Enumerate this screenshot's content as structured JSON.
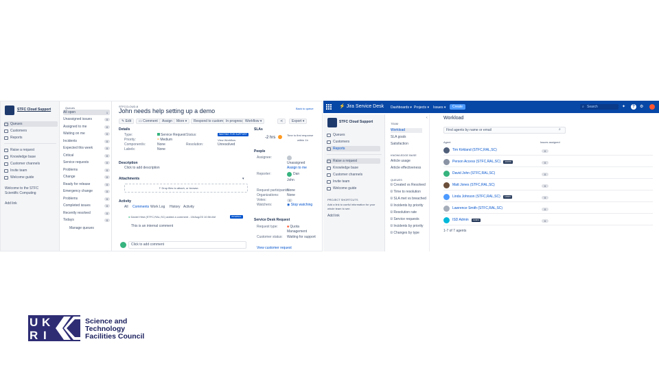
{
  "left_screenshot": {
    "project": {
      "name": "STFC Cloud Support"
    },
    "nav_items": [
      {
        "label": "Queues",
        "icon": "queues-icon"
      },
      {
        "label": "Customers",
        "icon": "customers-icon"
      },
      {
        "label": "Reports",
        "icon": "reports-icon"
      },
      {
        "label": "Raise a request",
        "icon": "raise-request-icon"
      },
      {
        "label": "Knowledge base",
        "icon": "knowledge-base-icon"
      },
      {
        "label": "Customer channels",
        "icon": "customer-channels-icon"
      },
      {
        "label": "Invite team",
        "icon": "invite-team-icon"
      },
      {
        "label": "Welcome guide",
        "icon": "welcome-guide-icon"
      }
    ],
    "sidebar_footer": [
      "Welcome to the STFC",
      "Scientific Computing",
      "Add link"
    ],
    "queues_header": "Queues",
    "queues": [
      {
        "label": "All open",
        "count": "1"
      },
      {
        "label": "Unassigned issues",
        "count": "0"
      },
      {
        "label": "Assigned to me",
        "count": "0"
      },
      {
        "label": "Waiting on me",
        "count": "0"
      },
      {
        "label": "Incidents",
        "count": "0"
      },
      {
        "label": "Expected this week",
        "count": "0"
      },
      {
        "label": "Critical",
        "count": "0"
      },
      {
        "label": "Service requests",
        "count": "0"
      },
      {
        "label": "Problems",
        "count": "0"
      },
      {
        "label": "Change",
        "count": "0"
      },
      {
        "label": "Ready for release",
        "count": "0"
      },
      {
        "label": "Emergency change",
        "count": "0"
      },
      {
        "label": "Problems",
        "count": "0"
      },
      {
        "label": "Completed issues",
        "count": "0"
      },
      {
        "label": "Recently resolved",
        "count": "0"
      },
      {
        "label": "Todays",
        "count": "0"
      }
    ],
    "queues_footer": "Manage queues",
    "issue": {
      "breadcrumb": "STFCCLOUD-8",
      "title": "John needs help setting up a demo",
      "back_link": "Back to queue",
      "toolbar": [
        "Edit",
        "Comment",
        "Assign",
        "More",
        "Respond to customer",
        "In progress",
        "Workflow"
      ],
      "export_label": "Export",
      "details_header": "Details",
      "detail_labels": [
        "Type:",
        "Priority:",
        "Component/s:",
        "Labels:"
      ],
      "detail_values": [
        "Service Request",
        "Medium",
        "None",
        "None"
      ],
      "status_label": "Status:",
      "status_value": "WAITING FOR SUPPORT",
      "workflow_value": "View Workflow",
      "resolution_label": "Resolution:",
      "resolution_value": "Unresolved",
      "description_header": "Description",
      "description_placeholder": "Click to add description",
      "attachments_header": "Attachments",
      "attachments_drop": "Drop files to attach, or browse.",
      "activity_header": "Activity",
      "activity_tabs": [
        "All",
        "Comments",
        "Work Log",
        "History",
        "Activity"
      ],
      "comment_author": "Daniel Hirst (STFC,RAL,SC) added a comment - 15/Aug/23 10:56 AM",
      "comment_badge": "INTERNAL",
      "comment_text": "This is an internal comment",
      "add_comment_placeholder": "Click to add comment",
      "sla_header": "SLAs",
      "sla_time": "-2 hrs",
      "sla_target": "Time to first response",
      "sla_goal": "within 1h",
      "people_header": "People",
      "people_labels": [
        "Assignee:",
        "Reporter:",
        "Request participants:",
        "Organizations:",
        "Votes:",
        "Watchers:"
      ],
      "people_values": [
        "Unassigned",
        "Assign to me",
        "Dan",
        "John",
        "None",
        "None",
        "0",
        "Stop watching"
      ],
      "request_header": "Service Desk Request",
      "request_type_label": "Request type:",
      "request_type_value": "Quota Management",
      "request_status_label": "Customer status:",
      "request_status_value": "Waiting for support",
      "request_link": "View customer request"
    }
  },
  "right_screenshot": {
    "top_nav": {
      "app_name": "Jira Service Desk",
      "items": [
        "Dashboards",
        "Projects",
        "Issues"
      ],
      "create_label": "Create",
      "search_placeholder": "Search"
    },
    "project": {
      "name": "STFC Cloud Support"
    },
    "nav_items": [
      {
        "label": "Queues",
        "icon": "queues-icon"
      },
      {
        "label": "Customers",
        "icon": "customers-icon"
      },
      {
        "label": "Reports",
        "icon": "reports-icon"
      },
      {
        "label": "Raise a request",
        "icon": "raise-request-icon"
      },
      {
        "label": "Knowledge base",
        "icon": "knowledge-base-icon"
      },
      {
        "label": "Customer channels",
        "icon": "customer-channels-icon"
      },
      {
        "label": "Invite team",
        "icon": "invite-team-icon"
      },
      {
        "label": "Welcome guide",
        "icon": "welcome-guide-icon"
      }
    ],
    "project_shortcuts_header": "PROJECT SHORTCUTS",
    "project_shortcuts_text": [
      "Add a link to useful information for your",
      "whole team to see."
    ],
    "add_link": "Add link",
    "reports_header": "TEAM",
    "reports_items": [
      "Workload",
      "SLA goals",
      "Satisfaction"
    ],
    "knowledge_header": "KNOWLEDGE BASE",
    "knowledge_items": [
      "Article usage",
      "Article effectiveness"
    ],
    "queues_header": "QUEUES",
    "queue_items": [
      "Created vs Resolved",
      "Time to resolution",
      "SLA met vs breached",
      "Incidents by priority",
      "Resolution rate",
      "Service requests",
      "Incidents by priority",
      "Changes by type"
    ],
    "workload": {
      "title": "Workload",
      "search_placeholder": "Find agents by name or email",
      "col_agent": "Agent",
      "col_issues": "Issues assigned",
      "agents": [
        {
          "name": "Tim Kirkland (STFC,RAL,SC)",
          "issues": "0",
          "badge": ""
        },
        {
          "name": "Person Access (STFC,RAL,SC)",
          "issues": "0",
          "badge": "ADMIN"
        },
        {
          "name": "David John (STFC,RAL,SC)",
          "issues": "0",
          "badge": ""
        },
        {
          "name": "Matt Jones (STFC,RAL,SC)",
          "issues": "0",
          "badge": ""
        },
        {
          "name": "Linda Johnson (STFC,RAL,SC)",
          "issues": "0",
          "badge": "ADMIN"
        },
        {
          "name": "Lawrence Smith (STFC,RAL,SC)",
          "issues": "0",
          "badge": ""
        },
        {
          "name": "ISD Admin",
          "issues": "0",
          "badge": "ADMIN"
        }
      ],
      "pagination": "1-7 of 7 agents"
    }
  },
  "branding": {
    "logo_letters": [
      "U",
      "K",
      "R",
      "I"
    ],
    "council_lines": [
      "Science and",
      "Technology",
      "Facilities Council"
    ]
  }
}
